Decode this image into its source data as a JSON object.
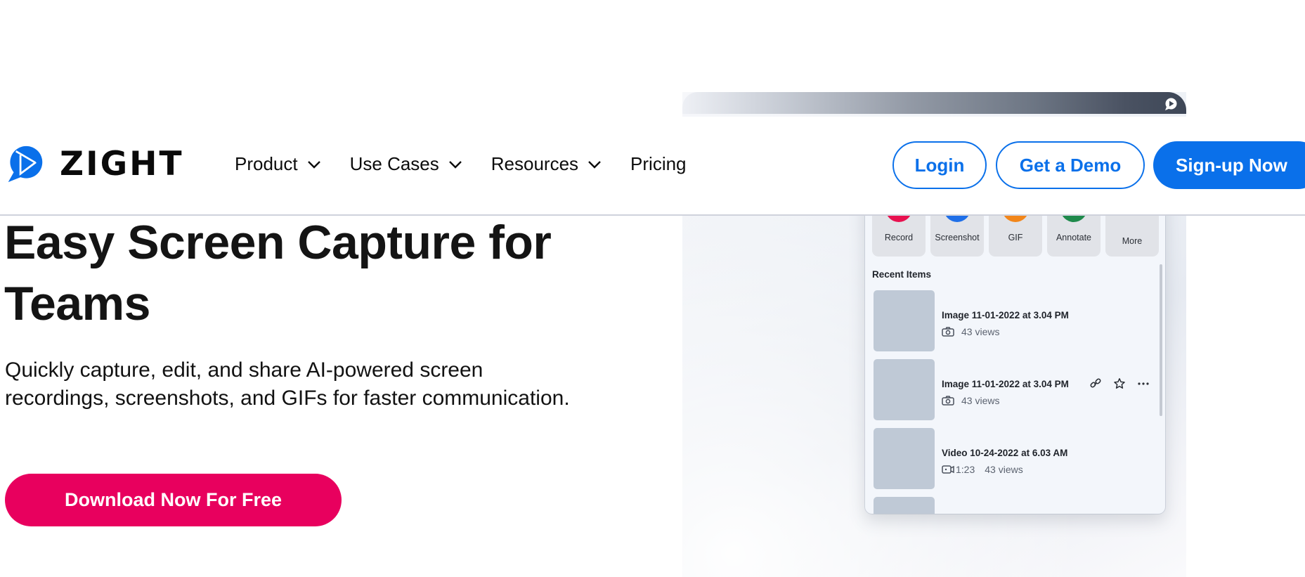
{
  "brand": {
    "name": "ZIGHT",
    "logo_icon": "zight-play-bubble-icon",
    "colors": {
      "primary_blue": "#0a70ea",
      "cta_pink": "#e8005e",
      "text_dark": "#141414"
    }
  },
  "nav": {
    "items": [
      {
        "label": "Product",
        "has_dropdown": true
      },
      {
        "label": "Use Cases",
        "has_dropdown": true
      },
      {
        "label": "Resources",
        "has_dropdown": true
      },
      {
        "label": "Pricing",
        "has_dropdown": false
      }
    ]
  },
  "header_actions": {
    "login": "Login",
    "demo": "Get a Demo",
    "signup": "Sign-up Now"
  },
  "hero": {
    "title": "Easy Screen Capture for Teams",
    "subtitle": "Quickly capture, edit, and share AI-powered screen recordings, screenshots, and GIFs for faster communication.",
    "cta": "Download Now For Free"
  },
  "app_preview": {
    "quick_actions": [
      {
        "label": "Record",
        "color": "#e8114f",
        "icon": "record-icon"
      },
      {
        "label": "Screenshot",
        "color": "#1f6fe8",
        "icon": "screenshot-icon"
      },
      {
        "label": "GIF",
        "color": "#f2861a",
        "icon": "gif-icon"
      },
      {
        "label": "Annotate",
        "color": "#1f8a4c",
        "icon": "annotate-icon"
      },
      {
        "label": "More",
        "color": "",
        "icon": ""
      }
    ],
    "recent_title": "Recent Items",
    "recent_items": [
      {
        "title": "Image 11-01-2022 at 3.04 PM",
        "type": "image",
        "duration": "",
        "views": "43 views",
        "show_actions": false
      },
      {
        "title": "Image 11-01-2022 at 3.04 PM",
        "type": "image",
        "duration": "",
        "views": "43 views",
        "show_actions": true
      },
      {
        "title": "Video 10-24-2022 at 6.03 AM",
        "type": "video",
        "duration": "1:23",
        "views": "43 views",
        "show_actions": false
      }
    ]
  }
}
